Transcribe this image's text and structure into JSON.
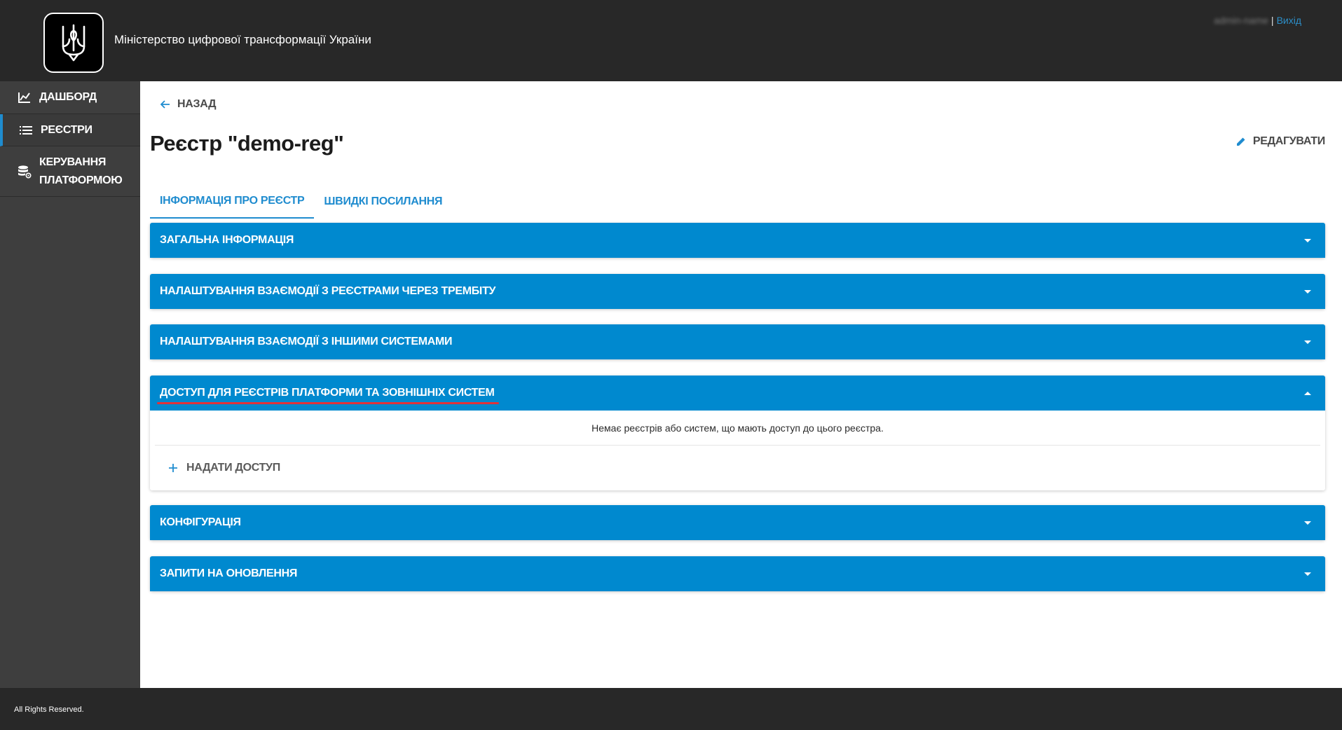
{
  "header": {
    "org_name": "Міністерство цифрової трансформації України",
    "user_name": "admin-name",
    "separator": "|",
    "logout_label": "Вихід"
  },
  "sidebar": {
    "items": [
      {
        "label": "Дашборд",
        "icon": "chart-icon"
      },
      {
        "label": "Реєстри",
        "icon": "list-icon"
      },
      {
        "label": "Керування платформою",
        "icon": "database-gear-icon"
      }
    ]
  },
  "main": {
    "back_label": "Назад",
    "title": "Реєстр \"demo-reg\"",
    "edit_label": "Редагувати",
    "tabs": [
      {
        "label": "Інформація про реєстр",
        "active": true
      },
      {
        "label": "Швидкі посилання",
        "active": false
      }
    ],
    "panels": [
      {
        "title": "Загальна інформація",
        "expanded": false
      },
      {
        "title": "Налаштування взаємодії з реєстрами через Трембіту",
        "expanded": false
      },
      {
        "title": "Налаштування взаємодії з іншими системами",
        "expanded": false
      },
      {
        "title": "Доступ для реєстрів платформи та зовнішніх систем",
        "expanded": true,
        "empty_message": "Немає реєстрів або систем, що мають доступ до цього реєстра.",
        "grant_label": "Надати доступ"
      },
      {
        "title": "Конфігурація",
        "expanded": false
      },
      {
        "title": "Запити на оновлення",
        "expanded": false
      }
    ]
  },
  "footer": {
    "text": "All Rights Reserved."
  },
  "colors": {
    "accent": "#0089cf",
    "header_bg": "#282828",
    "sidebar_bg": "#3e3e3e",
    "highlight": "#e0323a"
  }
}
